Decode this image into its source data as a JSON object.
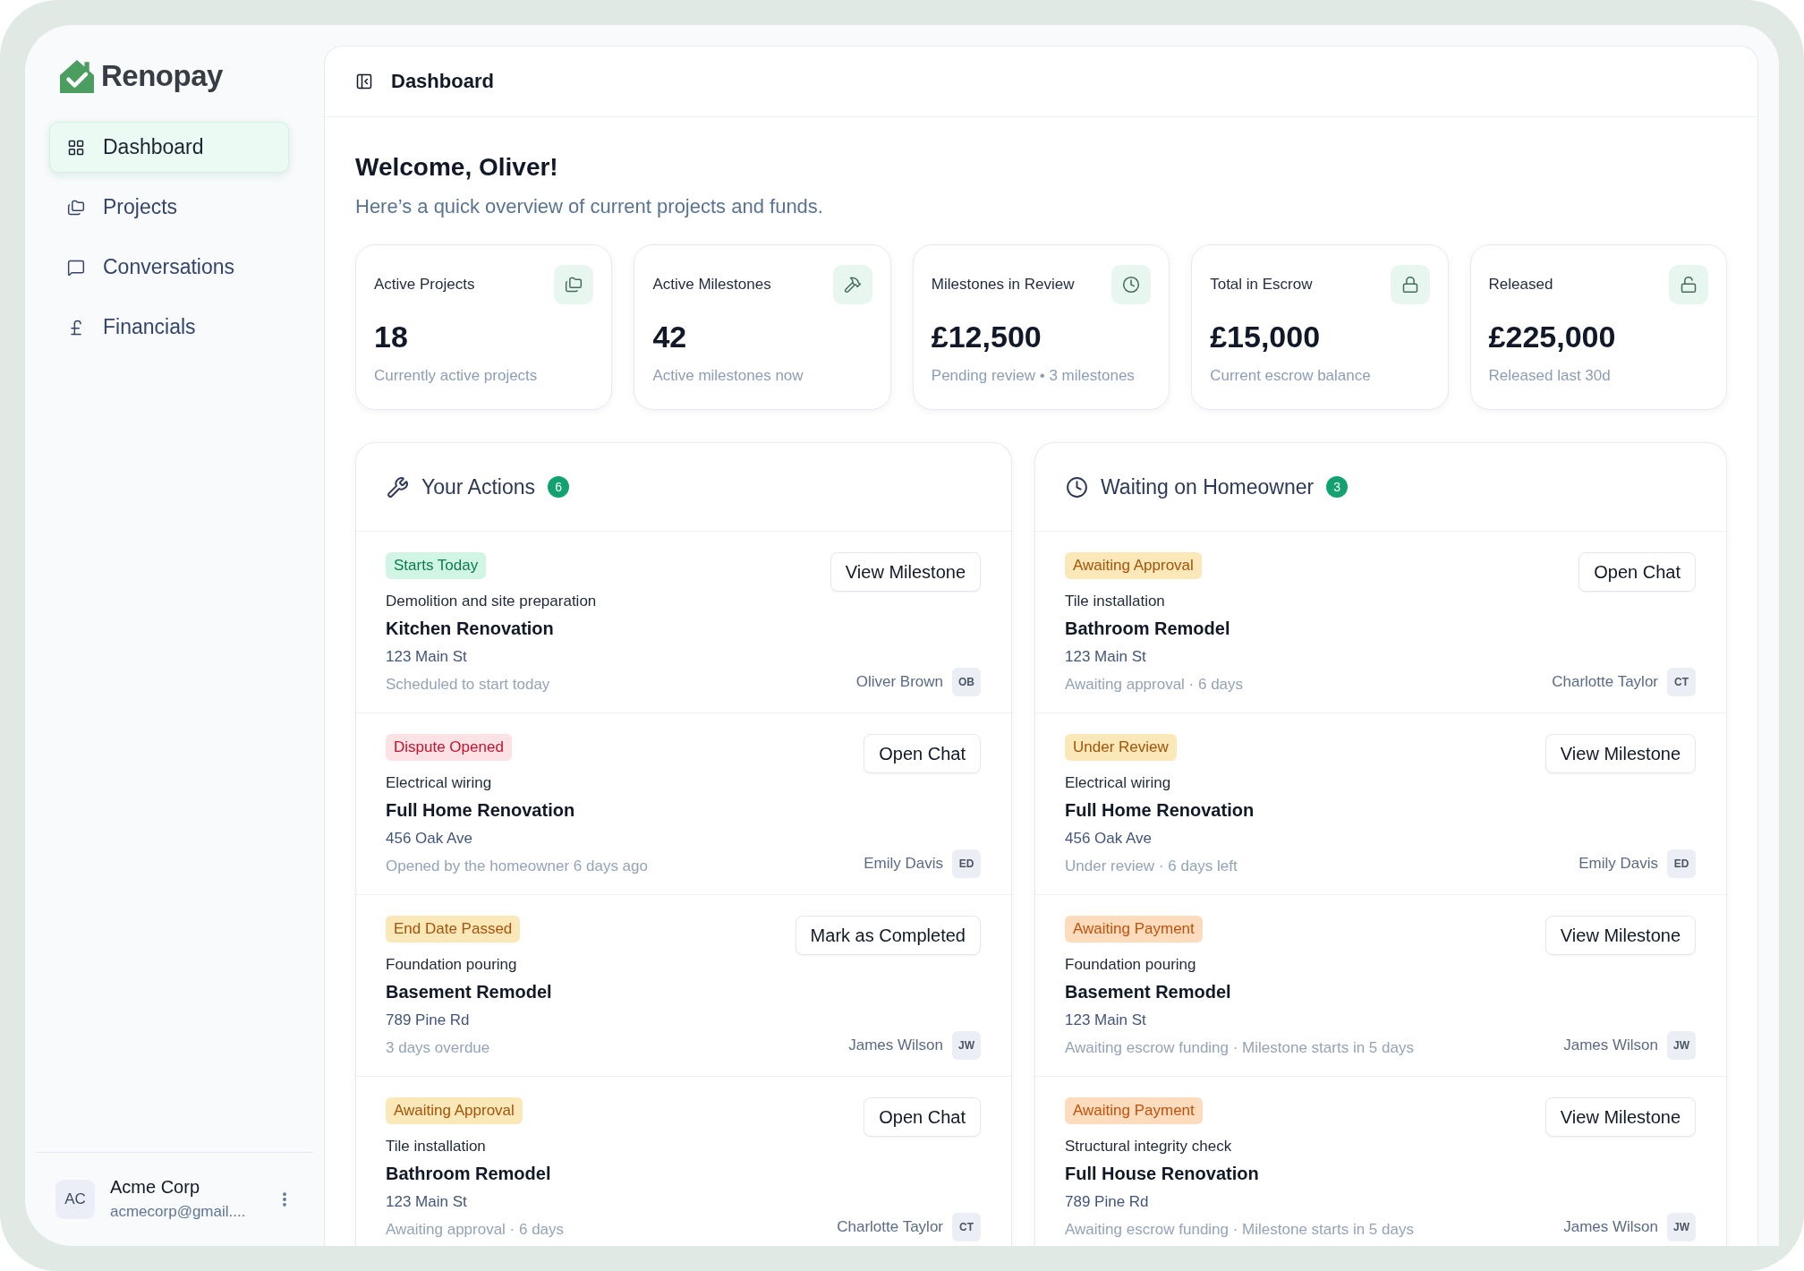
{
  "sidebar": {
    "brand": "Renopay",
    "nav": [
      {
        "label": "Dashboard",
        "selected": true
      },
      {
        "label": "Projects",
        "selected": false
      },
      {
        "label": "Conversations",
        "selected": false
      },
      {
        "label": "Financials",
        "selected": false
      }
    ],
    "account": {
      "initials": "AC",
      "name": "Acme Corp",
      "email": "acmecorp@gmail...."
    }
  },
  "header": {
    "title": "Dashboard"
  },
  "welcome": {
    "title": "Welcome, Oliver!",
    "subtitle": "Here’s a quick overview of current projects and funds."
  },
  "stats": [
    {
      "label": "Active Projects",
      "value": "18",
      "caption": "Currently active projects"
    },
    {
      "label": "Active Milestones",
      "value": "42",
      "caption": "Active milestones now"
    },
    {
      "label": "Milestones in Review",
      "value": "£12,500",
      "caption": "Pending review • 3 milestones"
    },
    {
      "label": "Total in Escrow",
      "value": "£15,000",
      "caption": "Current escrow balance"
    },
    {
      "label": "Released",
      "value": "£225,000",
      "caption": "Released last 30d"
    }
  ],
  "panels": [
    {
      "title": "Your Actions",
      "count": "6",
      "items": [
        {
          "tag": {
            "label": "Starts Today",
            "color": "#d1f5e5"
          },
          "task": "Demolition and site preparation",
          "project": "Kitchen Renovation",
          "address": "123 Main St",
          "note": "Scheduled to start today",
          "action": "View Milestone",
          "person": "Oliver Brown",
          "initials": "OB"
        },
        {
          "tag": {
            "label": "Dispute Opened",
            "color": "#fde2e5"
          },
          "task": "Electrical wiring",
          "project": "Full Home Renovation",
          "address": "456 Oak Ave",
          "note": "Opened by the homeowner 6 days ago",
          "action": "Open Chat",
          "person": "Emily Davis",
          "initials": "ED"
        },
        {
          "tag": {
            "label": "End Date Passed",
            "color": "#fbe8b8"
          },
          "task": "Foundation pouring",
          "project": "Basement Remodel",
          "address": "789 Pine Rd",
          "note": "3 days overdue",
          "action": "Mark as Completed",
          "person": "James Wilson",
          "initials": "JW"
        },
        {
          "tag": {
            "label": "Awaiting Approval",
            "color": "#fbe8b8"
          },
          "task": "Tile installation",
          "project": "Bathroom Remodel",
          "address": "123 Main St",
          "note": "Awaiting approval · 6 days",
          "action": "Open Chat",
          "person": "Charlotte Taylor",
          "initials": "CT"
        }
      ]
    },
    {
      "title": "Waiting on Homeowner",
      "count": "3",
      "items": [
        {
          "tag": {
            "label": "Awaiting Approval",
            "color": "#fbe8b8"
          },
          "task": "Tile installation",
          "project": "Bathroom Remodel",
          "address": "123 Main St",
          "note": "Awaiting approval · 6 days",
          "action": "Open Chat",
          "person": "Charlotte Taylor",
          "initials": "CT"
        },
        {
          "tag": {
            "label": "Under Review",
            "color": "#fbe8b8"
          },
          "task": "Electrical wiring",
          "project": "Full Home Renovation",
          "address": "456 Oak Ave",
          "note": "Under review · 6 days left",
          "action": "View Milestone",
          "person": "Emily Davis",
          "initials": "ED"
        },
        {
          "tag": {
            "label": "Awaiting Payment",
            "color": "#fddcbd"
          },
          "task": "Foundation pouring",
          "project": "Basement Remodel",
          "address": "123 Main St",
          "note": "Awaiting escrow funding · Milestone starts in 5 days",
          "action": "View Milestone",
          "person": "James Wilson",
          "initials": "JW"
        },
        {
          "tag": {
            "label": "Awaiting Payment",
            "color": "#fddcbd"
          },
          "task": "Structural integrity check",
          "project": "Full House Renovation",
          "address": "789 Pine Rd",
          "note": "Awaiting escrow funding · Milestone starts in 5 days",
          "action": "View Milestone",
          "person": "James Wilson",
          "initials": "JW"
        }
      ]
    }
  ]
}
